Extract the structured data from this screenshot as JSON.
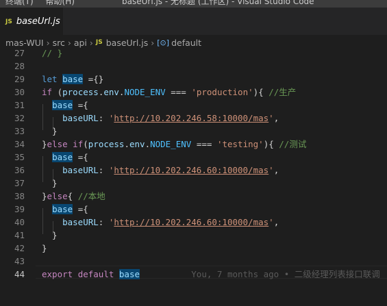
{
  "window": {
    "menu": [
      "终端(T)",
      "帮助(H)"
    ],
    "title": "baseUrl.js - 无标题 (工作区) - Visual Studio Code"
  },
  "tab": {
    "badge": "JS",
    "label": "baseUrl.js"
  },
  "breadcrumb": {
    "items": [
      "mas-WUI",
      "src",
      "api",
      "baseUrl.js",
      "default"
    ],
    "js_badge": "JS",
    "symbol_icon": "[⊙]"
  },
  "editor": {
    "active_line": 44,
    "lines": [
      {
        "n": "27",
        "text": "// }"
      },
      {
        "n": "28",
        "text": ""
      },
      {
        "n": "29",
        "text": "let base ={}"
      },
      {
        "n": "30",
        "text": "if (process.env.NODE_ENV === 'production'){ //生产"
      },
      {
        "n": "31",
        "text": "  base ={"
      },
      {
        "n": "32",
        "text": "    baseURL: 'http://10.202.246.58:10000/mas',"
      },
      {
        "n": "33",
        "text": "  }"
      },
      {
        "n": "34",
        "text": "}else if(process.env.NODE_ENV === 'testing'){ //测试"
      },
      {
        "n": "35",
        "text": "  base ={"
      },
      {
        "n": "36",
        "text": "    baseURL: 'http://10.202.246.60:10000/mas',"
      },
      {
        "n": "37",
        "text": "  }"
      },
      {
        "n": "38",
        "text": "}else{ //本地"
      },
      {
        "n": "39",
        "text": "  base ={"
      },
      {
        "n": "40",
        "text": "    baseURL: 'http://10.202.246.60:10000/mas',"
      },
      {
        "n": "41",
        "text": "  }"
      },
      {
        "n": "42",
        "text": "}"
      },
      {
        "n": "43",
        "text": ""
      },
      {
        "n": "44",
        "text": "export default base"
      }
    ],
    "blame": "You, 7 months ago • 二级经理列表接口联调"
  },
  "colors": {
    "background": "#1e1e1e",
    "keyword": "#569cd6",
    "control": "#c586c0",
    "string": "#ce9178",
    "comment": "#6a9955",
    "variable": "#9cdcfe",
    "constant": "#4fc1ff",
    "highlight": "#094771"
  }
}
